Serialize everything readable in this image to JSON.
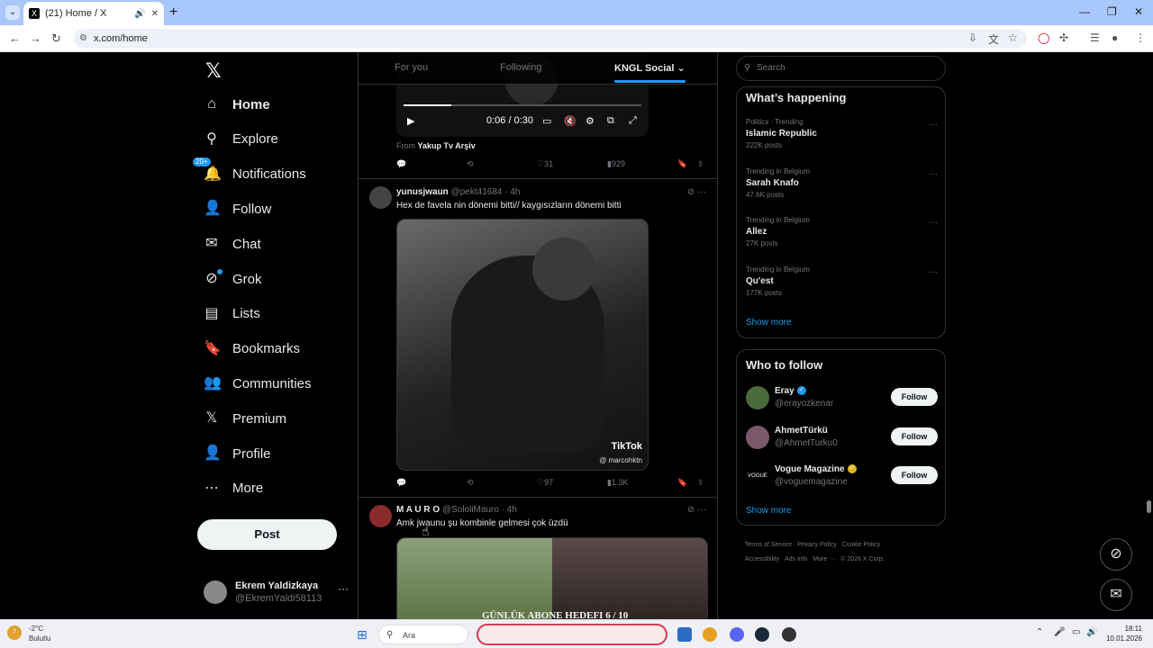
{
  "browser": {
    "tab_title": "(21) Home / X",
    "tab_favicon": "X",
    "url": "x.com/home"
  },
  "nav": {
    "logo": "𝕏",
    "items": [
      {
        "label": "Home",
        "icon": "home-icon",
        "glyph": "⌂"
      },
      {
        "label": "Explore",
        "icon": "search-icon",
        "glyph": "⚲"
      },
      {
        "label": "Notifications",
        "icon": "bell-icon",
        "glyph": "🔔",
        "badge": "20+"
      },
      {
        "label": "Follow",
        "icon": "add-person-icon",
        "glyph": "👤"
      },
      {
        "label": "Chat",
        "icon": "mail-icon",
        "glyph": "✉"
      },
      {
        "label": "Grok",
        "icon": "grok-icon",
        "glyph": "⊘"
      },
      {
        "label": "Lists",
        "icon": "list-icon",
        "glyph": "▤"
      },
      {
        "label": "Bookmarks",
        "icon": "bookmark-icon",
        "glyph": "🔖"
      },
      {
        "label": "Communities",
        "icon": "communities-icon",
        "glyph": "👥"
      },
      {
        "label": "Premium",
        "icon": "x-icon",
        "glyph": "𝕏"
      },
      {
        "label": "Profile",
        "icon": "person-icon",
        "glyph": "👤"
      },
      {
        "label": "More",
        "icon": "more-circle-icon",
        "glyph": "⋯"
      }
    ],
    "post_label": "Post",
    "account": {
      "name": "Ekrem Yaldizkaya",
      "handle": "@EkremYaldi58113"
    }
  },
  "feed": {
    "tabs": [
      "For you",
      "Following",
      "KNGL Social"
    ],
    "active_tab": "KNGL Social",
    "video": {
      "time": "0:06 / 0:30",
      "progress": 0.2
    },
    "from_prefix": "From",
    "from_name": "Yakup Tv Arşiv",
    "tweet0_actions": {
      "likes": "31",
      "views": "929"
    },
    "tweets": [
      {
        "name": "yunusjwaun",
        "handle": "@pekt41684",
        "time": "4h",
        "text": "Hex de favela nin dönemi bitti// kaygısızların dönemi bitti",
        "image_watermark": "TikTok",
        "image_user": "@ marcohktn",
        "likes": "97",
        "views": "1.3K"
      },
      {
        "name": "M A U R O",
        "handle": "@SololiMauro",
        "time": "4h",
        "text": "Amk jwaunu şu kombinle gelmesi çok üzdü",
        "image_caption": "GÜNLÜK ABONE HEDEFI      6  / 10"
      }
    ]
  },
  "sidebar": {
    "search_placeholder": "Search",
    "happening_title": "What’s happening",
    "trends": [
      {
        "meta": "Politics · Trending",
        "name": "Islamic Republic",
        "count": "222K posts"
      },
      {
        "meta": "Trending in Belgium",
        "name": "Sarah Knafo",
        "count": "47.6K posts"
      },
      {
        "meta": "Trending in Belgium",
        "name": "Allez",
        "count": "27K posts"
      },
      {
        "meta": "Trending in Belgium",
        "name": "Qu'est",
        "count": "177K posts"
      }
    ],
    "show_more": "Show more",
    "wtf_title": "Who to follow",
    "follow": [
      {
        "name": "Eray",
        "handle": "@erayozkenar",
        "verified_color": "#1d9bf0",
        "avatar_color": "#4a6a3a"
      },
      {
        "name": "AhmetTürkü",
        "handle": "@AhmetTurku0",
        "verified_color": "",
        "avatar_color": "#7a5a6a"
      },
      {
        "name": "Vogue Magazine",
        "handle": "@voguemagazine",
        "verified_color": "#e2b719",
        "avatar_color": "#000000",
        "avatar_text": "VOGUE"
      }
    ],
    "follow_label": "Follow",
    "footer": [
      "Terms of Service",
      "Privacy Policy",
      "Cookie Policy",
      "Accessibility",
      "Ads info",
      "More ···",
      "© 2026 X Corp."
    ]
  },
  "taskbar": {
    "weather_temp": "-2°C",
    "weather_desc": "Bulutlu",
    "weather_badge": "7",
    "search_label": "Ara",
    "time": "18:11",
    "date": "10.01.2026"
  }
}
